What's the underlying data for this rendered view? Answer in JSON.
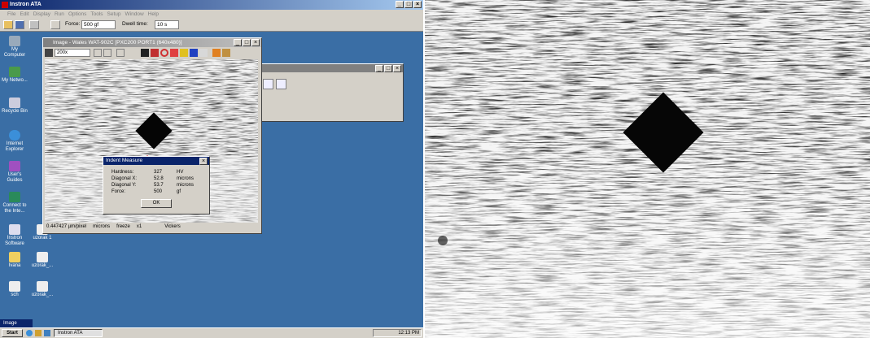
{
  "app": {
    "title": "Instron ATA",
    "menu": [
      "File",
      "Edit",
      "Display",
      "Run",
      "Options",
      "Tools",
      "Setup",
      "Window",
      "Help"
    ],
    "toolbar": {
      "force_label": "Force:",
      "force_value": "500 gf",
      "dwell_label": "Dwell time:",
      "dwell_value": "10 s"
    }
  },
  "desktop_icons": [
    {
      "label": "My Computer"
    },
    {
      "label": "My Netwo..."
    },
    {
      "label": "Recycle Bin"
    },
    {
      "label": "Internet Explorer"
    },
    {
      "label": "User's Guides"
    },
    {
      "label": "Connect to the Inte..."
    },
    {
      "label": "Instron Software"
    },
    {
      "label": "uzorak 1"
    },
    {
      "label": "Ivana"
    },
    {
      "label": "uzorak_..."
    },
    {
      "label": "sch"
    },
    {
      "label": "uzorak_..."
    }
  ],
  "image_window": {
    "title": "Image - Wales WAT-902C [PXC200 PORT1 (640x480)]",
    "zoom": "200x",
    "status": {
      "scale": "0.447427 µm/pixel",
      "units": "microns",
      "freeze": "freeze",
      "zoom": "x1",
      "method": "Vickers"
    }
  },
  "dialog": {
    "title": "Indent Measure",
    "rows": [
      {
        "label": "Hardness:",
        "value": "327",
        "unit": "HV"
      },
      {
        "label": "Diagonal X:",
        "value": "52.8",
        "unit": "microns"
      },
      {
        "label": "Diagonal Y:",
        "value": "53.7",
        "unit": "microns"
      },
      {
        "label": "Force:",
        "value": "500",
        "unit": "gf"
      }
    ],
    "ok_label": "OK"
  },
  "taskbar": {
    "start_label": "Start",
    "task_label": "Instron ATA",
    "clock": "12:13 PM",
    "mini_window": "Image"
  }
}
